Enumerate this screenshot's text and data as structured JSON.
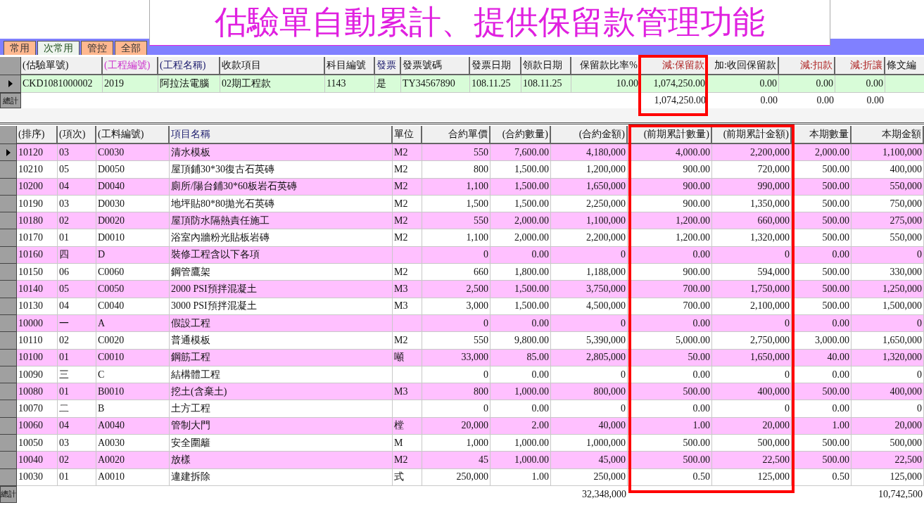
{
  "title": "估驗單自動累計、提供保留款管理功能",
  "tabs": [
    {
      "label": "常用",
      "selected": false
    },
    {
      "label": "次常用",
      "selected": true
    },
    {
      "label": "管控",
      "selected": false
    },
    {
      "label": "全部",
      "selected": false
    }
  ],
  "header_table": {
    "columns": [
      {
        "label": "(估驗單號)",
        "kind": "text"
      },
      {
        "label": "(工程編號)",
        "kind": "text",
        "color": "#cc33cc"
      },
      {
        "label": "(工程名稱)",
        "kind": "text",
        "color": "#202070"
      },
      {
        "label": "收款項目",
        "kind": "text"
      },
      {
        "label": "科目編號",
        "kind": "text"
      },
      {
        "label": "發票",
        "kind": "text",
        "color": "#202070"
      },
      {
        "label": "發票號碼",
        "kind": "text"
      },
      {
        "label": "發票日期",
        "kind": "text"
      },
      {
        "label": "領款日期",
        "kind": "text"
      },
      {
        "label": "保留款比率%",
        "kind": "number"
      },
      {
        "label": "減:保留款",
        "kind": "number",
        "color": "#b02828"
      },
      {
        "label": "加:收回保留款",
        "kind": "number"
      },
      {
        "label": "減:扣款",
        "kind": "number",
        "color": "#b02828"
      },
      {
        "label": "減:折讓",
        "kind": "number",
        "color": "#b02828"
      },
      {
        "label": "條文編",
        "kind": "text"
      }
    ],
    "rows": [
      {
        "selected": true,
        "cells": [
          "CKD1081000002",
          "2019",
          "阿拉法電腦",
          "02期工程款",
          "1143",
          "是",
          "TY34567890",
          "108.11.25",
          "108.11.25",
          "10.00",
          "1,074,250.00",
          "0.00",
          "0.00",
          "0.00",
          null
        ]
      }
    ],
    "totals": {
      "label": "總計",
      "cells": [
        null,
        null,
        null,
        null,
        null,
        null,
        null,
        null,
        null,
        null,
        "1,074,250.00",
        "0.00",
        "0.00",
        "0.00",
        null
      ]
    }
  },
  "items_table": {
    "columns": [
      {
        "label": "(排序)",
        "kind": "text"
      },
      {
        "label": "(項次)",
        "kind": "text"
      },
      {
        "label": "(工料編號)",
        "kind": "text"
      },
      {
        "label": "項目名稱",
        "kind": "text",
        "color": "#202070"
      },
      {
        "label": "單位",
        "kind": "text"
      },
      {
        "label": "合約單價",
        "kind": "number"
      },
      {
        "label": "(合約數量)",
        "kind": "number"
      },
      {
        "label": "(合約金額)",
        "kind": "number"
      },
      {
        "label": "(前期累計數量)",
        "kind": "number"
      },
      {
        "label": "(前期累計金額)",
        "kind": "number"
      },
      {
        "label": "本期數量",
        "kind": "number"
      },
      {
        "label": "本期金額",
        "kind": "number"
      }
    ],
    "rows": [
      {
        "selected": true,
        "cells": [
          "10120",
          "03",
          "C0030",
          "清水模板",
          "M2",
          "550",
          "7,600.00",
          "4,180,000",
          "4,000.00",
          "2,200,000",
          "2,000.00",
          "1,100,000"
        ]
      },
      {
        "selected": false,
        "cells": [
          "10210",
          "05",
          "D0050",
          "屋頂鋪30*30復古石英磚",
          "M2",
          "800",
          "1,500.00",
          "1,200,000",
          "900.00",
          "720,000",
          "500.00",
          "400,000"
        ]
      },
      {
        "selected": false,
        "cells": [
          "10200",
          "04",
          "D0040",
          "廁所/陽台鋪30*60板岩石英磚",
          "M2",
          "1,100",
          "1,500.00",
          "1,650,000",
          "900.00",
          "990,000",
          "500.00",
          "550,000"
        ]
      },
      {
        "selected": false,
        "cells": [
          "10190",
          "03",
          "D0030",
          "地坪貼80*80拋光石英磚",
          "M2",
          "1,500",
          "1,500.00",
          "2,250,000",
          "900.00",
          "1,350,000",
          "500.00",
          "750,000"
        ]
      },
      {
        "selected": false,
        "cells": [
          "10180",
          "02",
          "D0020",
          "屋頂防水隔熱責任施工",
          "M2",
          "550",
          "2,000.00",
          "1,100,000",
          "1,200.00",
          "660,000",
          "500.00",
          "275,000"
        ]
      },
      {
        "selected": false,
        "cells": [
          "10170",
          "01",
          "D0010",
          "浴室內牆粉光貼板岩磚",
          "M2",
          "1,100",
          "2,000.00",
          "2,200,000",
          "1,200.00",
          "1,320,000",
          "500.00",
          "550,000"
        ]
      },
      {
        "selected": false,
        "cells": [
          "10160",
          "四",
          "D",
          "裝修工程含以下各項",
          null,
          "0",
          "0.00",
          "0",
          "0.00",
          "0",
          "0.00",
          "0"
        ]
      },
      {
        "selected": false,
        "cells": [
          "10150",
          "06",
          "C0060",
          "鋼管鷹架",
          "M2",
          "660",
          "1,800.00",
          "1,188,000",
          "900.00",
          "594,000",
          "500.00",
          "330,000"
        ]
      },
      {
        "selected": false,
        "cells": [
          "10140",
          "05",
          "C0050",
          "2000 PSI預拌混凝土",
          "M3",
          "2,500",
          "1,500.00",
          "3,750,000",
          "700.00",
          "1,750,000",
          "500.00",
          "1,250,000"
        ]
      },
      {
        "selected": false,
        "cells": [
          "10130",
          "04",
          "C0040",
          "3000 PSI預拌混凝土",
          "M3",
          "3,000",
          "1,500.00",
          "4,500,000",
          "700.00",
          "2,100,000",
          "500.00",
          "1,500,000"
        ]
      },
      {
        "selected": false,
        "cells": [
          "10000",
          "一",
          "A",
          "假設工程",
          null,
          "0",
          "0.00",
          "0",
          "0.00",
          "0",
          "0.00",
          "0"
        ]
      },
      {
        "selected": false,
        "cells": [
          "10110",
          "02",
          "C0020",
          "普通模板",
          "M2",
          "550",
          "9,800.00",
          "5,390,000",
          "5,000.00",
          "2,750,000",
          "3,000.00",
          "1,650,000"
        ]
      },
      {
        "selected": false,
        "cells": [
          "10100",
          "01",
          "C0010",
          "鋼筋工程",
          "噸",
          "33,000",
          "85.00",
          "2,805,000",
          "50.00",
          "1,650,000",
          "40.00",
          "1,320,000"
        ]
      },
      {
        "selected": false,
        "cells": [
          "10090",
          "三",
          "C",
          "結構體工程",
          null,
          "0",
          "0.00",
          "0",
          "0.00",
          "0",
          "0.00",
          "0"
        ]
      },
      {
        "selected": false,
        "cells": [
          "10080",
          "01",
          "B0010",
          "挖土(含棄土)",
          "M3",
          "800",
          "1,000.00",
          "800,000",
          "500.00",
          "400,000",
          "500.00",
          "400,000"
        ]
      },
      {
        "selected": false,
        "cells": [
          "10070",
          "二",
          "B",
          "土方工程",
          null,
          "0",
          "0.00",
          "0",
          "0.00",
          "0",
          "0.00",
          "0"
        ]
      },
      {
        "selected": false,
        "cells": [
          "10060",
          "04",
          "A0040",
          "管制大門",
          "樘",
          "20,000",
          "2.00",
          "40,000",
          "1.00",
          "20,000",
          "1.00",
          "20,000"
        ]
      },
      {
        "selected": false,
        "cells": [
          "10050",
          "03",
          "A0030",
          "安全圍籬",
          "M",
          "1,000",
          "1,000.00",
          "1,000,000",
          "500.00",
          "500,000",
          "500.00",
          "500,000"
        ]
      },
      {
        "selected": false,
        "cells": [
          "10040",
          "02",
          "A0020",
          "放樣",
          "M2",
          "45",
          "1,000.00",
          "45,000",
          "500.00",
          "22,500",
          "500.00",
          "22,500"
        ]
      },
      {
        "selected": false,
        "cells": [
          "10030",
          "01",
          "A0010",
          "違建拆除",
          "式",
          "250,000",
          "1.00",
          "250,000",
          "0.50",
          "125,000",
          "0.50",
          "125,000"
        ]
      }
    ],
    "totals": {
      "label": "總計",
      "cells": [
        null,
        null,
        null,
        null,
        null,
        null,
        null,
        "32,348,000",
        null,
        null,
        null,
        "10,742,500"
      ]
    }
  }
}
